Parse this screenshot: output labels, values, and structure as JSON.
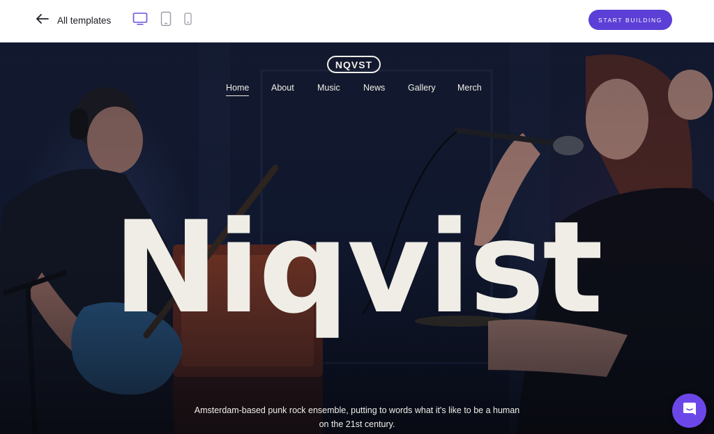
{
  "topbar": {
    "back_label": "All templates",
    "cta_label": "START BUILDING",
    "devices": [
      "desktop",
      "tablet",
      "mobile"
    ],
    "active_device": "desktop",
    "accent": "#5b3fd6",
    "active_device_color": "#6c4ee0"
  },
  "site": {
    "logo": "NQVST",
    "nav": [
      {
        "label": "Home",
        "active": true
      },
      {
        "label": "About",
        "active": false
      },
      {
        "label": "Music",
        "active": false
      },
      {
        "label": "News",
        "active": false
      },
      {
        "label": "Gallery",
        "active": false
      },
      {
        "label": "Merch",
        "active": false
      }
    ],
    "headline": "Niqvist",
    "tagline_line1": "Amsterdam-based punk rock ensemble, putting to words what it's like to be a human",
    "tagline_line2": "on the 21st century."
  },
  "chat": {
    "icon": "chat-bubble-icon",
    "color": "#6c47e8"
  }
}
